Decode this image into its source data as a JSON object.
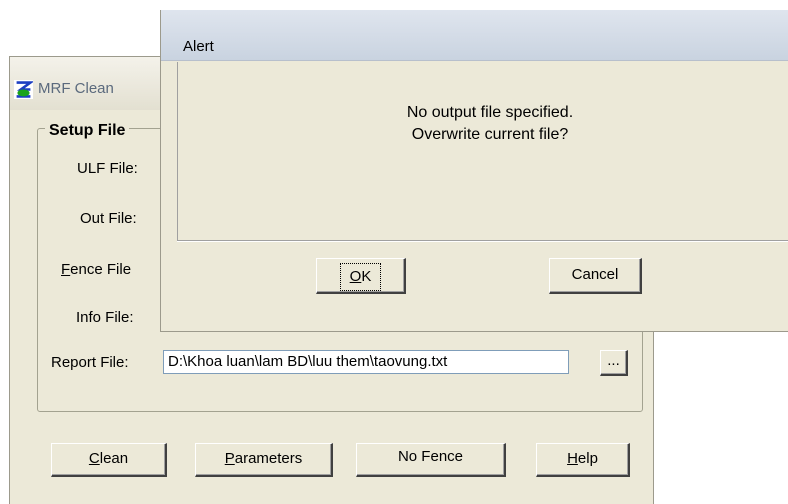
{
  "main_window": {
    "title": "MRF Clean",
    "group_title": "Setup File",
    "labels": {
      "ulf": "ULF File:",
      "out": "Out File:",
      "fence_first": "F",
      "fence_rest": "ence File",
      "info": "Info File:",
      "report": "Report File:"
    },
    "report_value": "D:\\Khoa luan\\lam BD\\luu them\\taovung.txt",
    "browse_label": "...",
    "buttons": {
      "clean_first": "C",
      "clean_rest": "lean",
      "params_first": "P",
      "params_rest": "arameters",
      "nofence": "No Fence",
      "help_first": "H",
      "help_rest": "elp"
    }
  },
  "alert": {
    "title": "Alert",
    "line1": "No output file specified.",
    "line2": "Overwrite current file?",
    "ok_first": "O",
    "ok_rest": "K",
    "cancel": "Cancel"
  },
  "icons": {
    "app_icon": "mrf-app-icon"
  }
}
